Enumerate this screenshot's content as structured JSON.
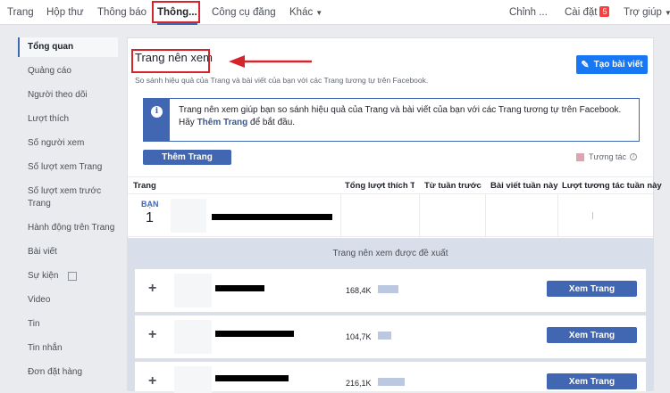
{
  "topnav": {
    "items": [
      "Trang",
      "Hộp thư",
      "Thông báo",
      "Thông...",
      "Công cụ đăng",
      "Khác",
      "Chỉnh ...",
      "Cài đặt",
      "Trợ giúp"
    ],
    "settings_badge": "5"
  },
  "sidebar": {
    "items": [
      "Tổng quan",
      "Quảng cáo",
      "Người theo dõi",
      "Lượt thích",
      "Số người xem",
      "Số lượt xem Trang",
      "Số lượt xem trước Trang",
      "Hành động trên Trang",
      "Bài viết",
      "Sự kiện",
      "Video",
      "Tin",
      "Tin nhắn",
      "Đơn đặt hàng"
    ]
  },
  "main": {
    "title": "Trang nên xem",
    "subtitle": "So sánh hiệu quả của Trang và bài viết của bạn với các Trang tương tự trên Facebook.",
    "create_post": "Tạo bài viết",
    "info_line1": "Trang nên xem giúp bạn so sánh hiệu quả của Trang và bài viết của bạn với các Trang tương tự trên Facebook.",
    "info_line2_pre": "Hãy ",
    "info_link": "Thêm Trang",
    "info_line2_post": " để bắt đầu.",
    "add_page": "Thêm Trang",
    "legend": "Tương tác"
  },
  "table": {
    "headers": [
      "Trang",
      "Tổng lượt thích Trang",
      "Từ tuần trước",
      "Bài viết tuần này",
      "Lượt tương tác tuần này"
    ],
    "you_label": "BẠN",
    "you_rank": "1"
  },
  "suggested": {
    "heading": "Trang nên xem được đề xuất",
    "rows": [
      {
        "likes": "168,4K",
        "bar": 0.33,
        "button": "Xem Trang"
      },
      {
        "likes": "104,7K",
        "bar": 0.21,
        "button": "Xem Trang"
      },
      {
        "likes": "216,1K",
        "bar": 0.43,
        "button": "Xem Trang"
      }
    ]
  },
  "colors": {
    "accent": "#4267b2",
    "annotation": "#d6242c",
    "cta": "#1877f2"
  }
}
